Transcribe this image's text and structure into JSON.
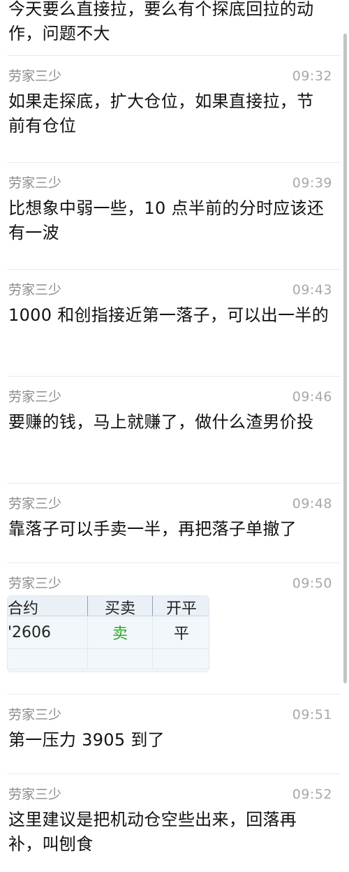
{
  "messages": [
    {
      "sender": "",
      "time": "",
      "text": "今天要么直接拉，要么有个探底回拉的动作，问题不大"
    },
    {
      "sender": "劳家三少",
      "time": "09:32",
      "text": "如果走探底，扩大仓位，如果直接拉，节前有仓位"
    },
    {
      "sender": "劳家三少",
      "time": "09:39",
      "text": "比想象中弱一些，10 点半前的分时应该还有一波"
    },
    {
      "sender": "劳家三少",
      "time": "09:43",
      "text": "1000 和创指接近第一落子，可以出一半的"
    },
    {
      "sender": "劳家三少",
      "time": "09:46",
      "text": "要赚的钱，马上就赚了，做什么渣男价投"
    },
    {
      "sender": "劳家三少",
      "time": "09:48",
      "text": "靠落子可以手卖一半，再把落子单撤了"
    },
    {
      "sender": "劳家三少",
      "time": "09:50",
      "image": {
        "headers": [
          "合约",
          "买卖",
          "开平"
        ],
        "row": [
          "'2606",
          "卖",
          "平"
        ],
        "sell_color": "#2ea82e"
      }
    },
    {
      "sender": "劳家三少",
      "time": "09:51",
      "text": "第一压力 3905 到了"
    },
    {
      "sender": "劳家三少",
      "time": "09:52",
      "text": "这里建议是把机动仓空些出来，回落再补，叫刨食"
    }
  ]
}
